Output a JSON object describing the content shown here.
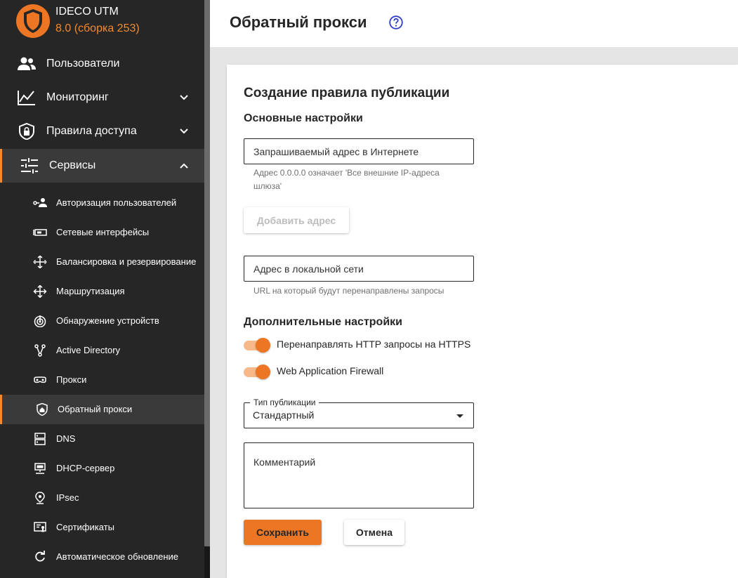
{
  "brand": {
    "name": "IDECO UTM",
    "version": "8.0 (сборка 253)",
    "logo_icon": "shield-logo-icon"
  },
  "colors": {
    "accent": "#ec7623",
    "sidebar_bg": "#262626",
    "active_item_bg": "#3a3a3a"
  },
  "sidebar": {
    "main_items": [
      {
        "label": "Пользователи",
        "icon": "users-icon",
        "expandable": false
      },
      {
        "label": "Мониторинг",
        "icon": "chart-line-icon",
        "expandable": true,
        "expanded": false
      },
      {
        "label": "Правила доступа",
        "icon": "shield-lock-icon",
        "expandable": true,
        "expanded": false
      },
      {
        "label": "Сервисы",
        "icon": "sliders-icon",
        "expandable": true,
        "expanded": true
      }
    ],
    "sub_items": [
      {
        "label": "Авторизация пользователей",
        "icon": "user-key-icon"
      },
      {
        "label": "Сетевые интерфейсы",
        "icon": "network-card-icon"
      },
      {
        "label": "Балансировка и резервирование",
        "icon": "arrows-split-icon"
      },
      {
        "label": "Маршрутизация",
        "icon": "arrows-move-icon"
      },
      {
        "label": "Обнаружение устройств",
        "icon": "radar-icon"
      },
      {
        "label": "Active Directory",
        "icon": "directory-tree-icon"
      },
      {
        "label": "Прокси",
        "icon": "mask-icon"
      },
      {
        "label": "Обратный прокси",
        "icon": "shield-home-icon",
        "active": true
      },
      {
        "label": "DNS",
        "icon": "server-icon"
      },
      {
        "label": "DHCP-сервер",
        "icon": "dhcp-icon"
      },
      {
        "label": "IPsec",
        "icon": "location-pin-icon"
      },
      {
        "label": "Сертификаты",
        "icon": "certificate-icon"
      },
      {
        "label": "Автоматическое обновление",
        "icon": "refresh-icon"
      }
    ]
  },
  "header": {
    "title": "Обратный прокси",
    "help_icon": "help-icon"
  },
  "form": {
    "title": "Создание правила публикации",
    "basic_section": "Основные настройки",
    "external_address": {
      "placeholder": "Запрашиваемый адрес в Интернете",
      "value": "",
      "hint": "Адрес 0.0.0.0 означает 'Все внешние IP-адреса шлюза'"
    },
    "add_address_label": "Добавить адрес",
    "local_address": {
      "placeholder": "Адрес в локальной сети",
      "value": "",
      "hint": "URL на который будут перенаправлены запросы"
    },
    "extra_section": "Дополнительные настройки",
    "toggles": [
      {
        "label": "Перенаправлять HTTP запросы на HTTPS",
        "on": true
      },
      {
        "label": "Web Application Firewall",
        "on": true
      }
    ],
    "publication_type": {
      "legend": "Тип публикации",
      "value": "Стандартный"
    },
    "comment": {
      "placeholder": "Комментарий",
      "value": ""
    },
    "save_label": "Сохранить",
    "cancel_label": "Отмена"
  }
}
